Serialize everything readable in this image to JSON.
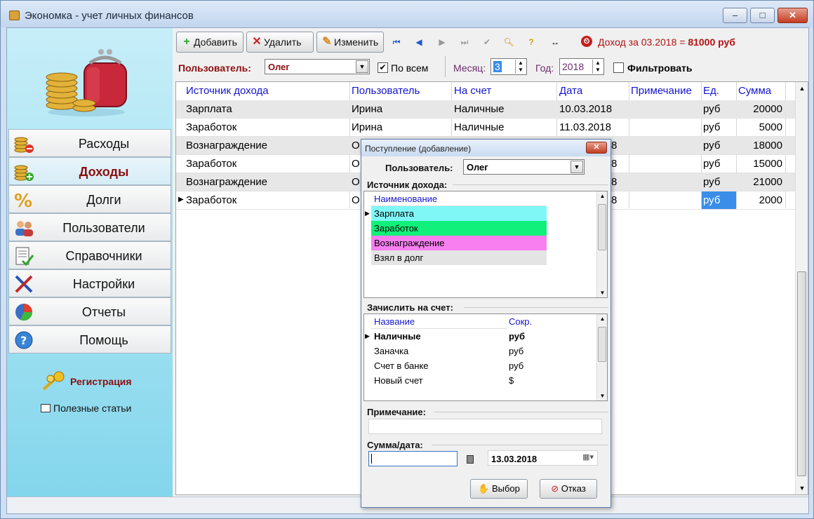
{
  "window": {
    "title": "Экономка - учет личных финансов",
    "min": "–",
    "max": "□",
    "close": "✕"
  },
  "sidebar": {
    "items": [
      {
        "label": "Расходы",
        "icon": "coins-minus-icon"
      },
      {
        "label": "Доходы",
        "icon": "coins-plus-icon"
      },
      {
        "label": "Долги",
        "icon": "percent-icon"
      },
      {
        "label": "Пользователи",
        "icon": "users-icon"
      },
      {
        "label": "Справочники",
        "icon": "checklist-icon"
      },
      {
        "label": "Настройки",
        "icon": "tools-icon"
      },
      {
        "label": "Отчеты",
        "icon": "pie-chart-icon"
      },
      {
        "label": "Помощь",
        "icon": "help-icon"
      }
    ],
    "registration": "Регистрация",
    "useful": "Полезные статьи"
  },
  "toolbar": {
    "add": "Добавить",
    "delete": "Удалить",
    "edit": "Изменить",
    "income_label": "Доход за 03.2018 =",
    "income_value": "81000 руб"
  },
  "filter": {
    "user_label": "Пользователь:",
    "user_value": "Олег",
    "all_label": "По всем",
    "month_label": "Месяц:",
    "month_value": "3",
    "year_label": "Год:",
    "year_value": "2018",
    "filter_label": "Фильтровать"
  },
  "grid": {
    "headers": [
      "Источник дохода",
      "Пользователь",
      "На счет",
      "Дата",
      "Примечание",
      "Ед.",
      "Сумма"
    ],
    "rows": [
      [
        "Зарплата",
        "Ирина",
        "Наличные",
        "10.03.2018",
        "",
        "руб",
        "20000"
      ],
      [
        "Заработок",
        "Ирина",
        "Наличные",
        "11.03.2018",
        "",
        "руб",
        "5000"
      ],
      [
        "Вознаграждение",
        "О",
        "",
        "8",
        "",
        "руб",
        "18000"
      ],
      [
        "Заработок",
        "О",
        "",
        "8",
        "",
        "руб",
        "15000"
      ],
      [
        "Вознаграждение",
        "О",
        "",
        "8",
        "",
        "руб",
        "21000"
      ],
      [
        "Заработок",
        "О",
        "",
        "8",
        "",
        "руб",
        "2000"
      ]
    ]
  },
  "dialog": {
    "title": "Поступление (добавление)",
    "user_label": "Пользователь:",
    "user_value": "Олег",
    "source_label": "Источник дохода:",
    "source_header": "Наименование",
    "sources": [
      {
        "name": "Зарплата",
        "color": "#7ff7f7"
      },
      {
        "name": "Заработок",
        "color": "#10f07a"
      },
      {
        "name": "Вознаграждение",
        "color": "#f77ff0"
      },
      {
        "name": "Взял в долг",
        "color": "#e4e4e4"
      }
    ],
    "account_label": "Зачислить на счет:",
    "account_headers": [
      "Название",
      "Сокр."
    ],
    "accounts": [
      [
        "Наличные",
        "руб"
      ],
      [
        "Заначка",
        "руб"
      ],
      [
        "Счет в банке",
        "руб"
      ],
      [
        "Новый счет",
        "$"
      ]
    ],
    "note_label": "Примечание:",
    "sum_label": "Сумма/дата:",
    "date_value": "13.03.2018",
    "ok": "Выбор",
    "cancel": "Отказ"
  }
}
